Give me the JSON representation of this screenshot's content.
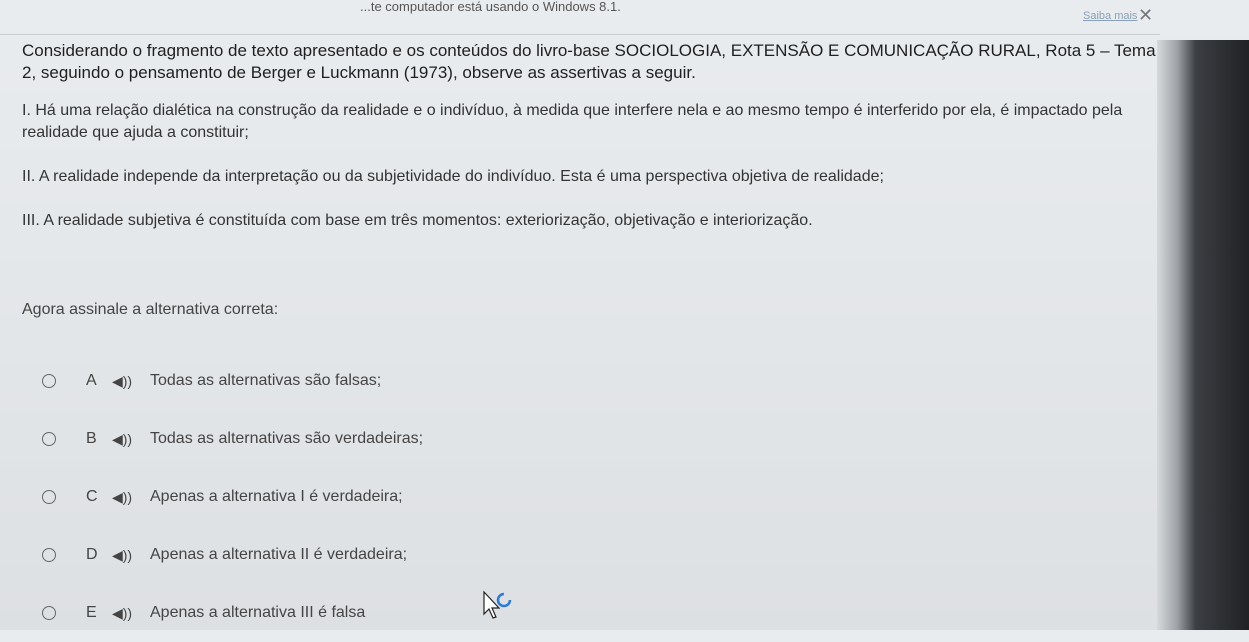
{
  "banner": {
    "text": "...te computador está usando o Windows 8.1.",
    "link": "Saiba mais",
    "close": "✕"
  },
  "question": "Considerando o fragmento de texto apresentado e os conteúdos do livro-base SOCIOLOGIA, EXTENSÃO E COMUNICAÇÃO RURAL, Rota 5 – Tema 2, seguindo o pensamento de Berger e Luckmann (1973), observe as assertivas a seguir.",
  "assertions": [
    "I. Há uma relação dialética na construção da realidade e o indivíduo, à medida que interfere nela e ao mesmo tempo é interferido por ela, é impactado pela realidade que ajuda a constituir;",
    "II. A realidade independe da interpretação ou da subjetividade do indivíduo. Esta é uma perspectiva objetiva de realidade;",
    "III. A realidade subjetiva é constituída com base em três momentos: exteriorização, objetivação e interiorização."
  ],
  "prompt": "Agora assinale a alternativa correta:",
  "options": [
    {
      "letter": "A",
      "text": "Todas as alternativas são falsas;"
    },
    {
      "letter": "B",
      "text": "Todas as alternativas são verdadeiras;"
    },
    {
      "letter": "C",
      "text": "Apenas a alternativa I é verdadeira;"
    },
    {
      "letter": "D",
      "text": "Apenas a alternativa II é verdadeira;"
    },
    {
      "letter": "E",
      "text": "Apenas a alternativa III é falsa"
    }
  ],
  "icons": {
    "speaker": "speaker-icon",
    "cursor": "busy-cursor-icon"
  }
}
